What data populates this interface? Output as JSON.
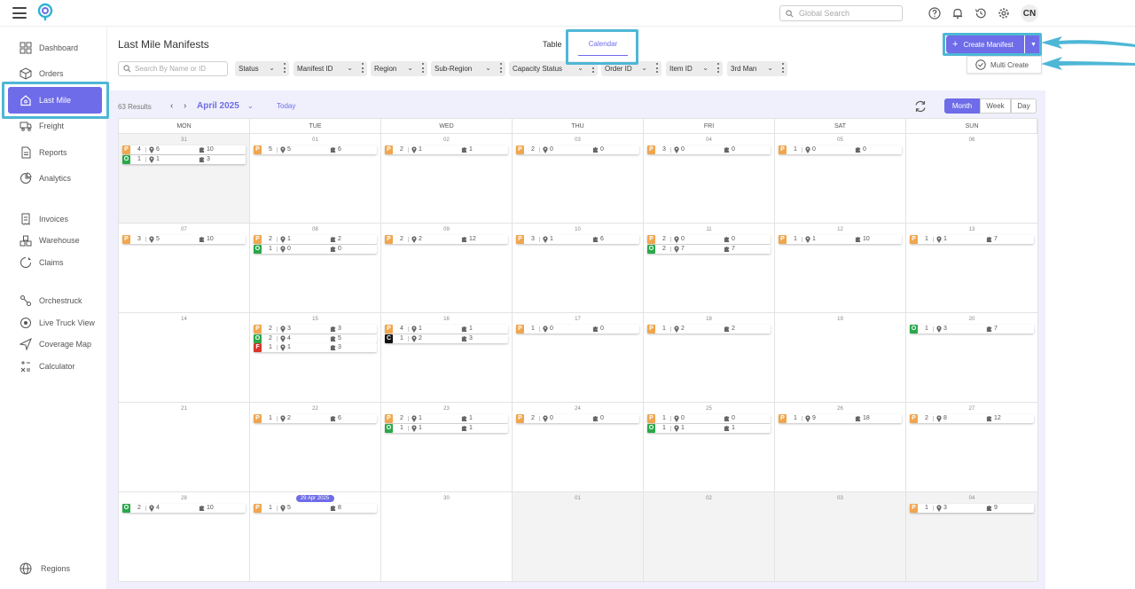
{
  "app": {
    "logo": "logo-mark"
  },
  "topbar": {
    "search_placeholder": "Global Search",
    "user_initials": "CN"
  },
  "sidebar": {
    "items": [
      {
        "label": "Dashboard",
        "icon": "dashboard-icon"
      },
      {
        "label": "Orders",
        "icon": "box-icon"
      },
      {
        "label": "Last Mile",
        "icon": "house-icon"
      },
      {
        "label": "Freight",
        "icon": "truck-icon"
      },
      {
        "label": "Reports",
        "icon": "report-icon"
      },
      {
        "label": "Analytics",
        "icon": "analytics-icon"
      },
      {
        "label": "Invoices",
        "icon": "invoice-icon"
      },
      {
        "label": "Warehouse",
        "icon": "warehouse-icon"
      },
      {
        "label": "Claims",
        "icon": "claims-icon"
      },
      {
        "label": "Orchestruck",
        "icon": "orchestruck-icon"
      },
      {
        "label": "Live Truck View",
        "icon": "live-icon"
      },
      {
        "label": "Coverage Map",
        "icon": "map-icon"
      },
      {
        "label": "Calculator",
        "icon": "calculator-icon"
      }
    ],
    "footer_label": "Regions"
  },
  "page": {
    "title": "Last Mile Manifests",
    "tabs": [
      "Table",
      "Calendar"
    ],
    "create_label": "Create Manifest",
    "multi_create_label": "Multi Create"
  },
  "filters": {
    "search_placeholder": "Search By Name or ID",
    "chips": [
      "Status",
      "Manifest ID",
      "Region",
      "Sub-Region",
      "Capacity Status",
      "Order ID",
      "Item ID",
      "3rd Man"
    ]
  },
  "calendar": {
    "results": "63 Results",
    "month_label": "April 2025",
    "today_label": "Today",
    "views": [
      "Month",
      "Week",
      "Day"
    ],
    "active_view": "Month",
    "weekdays": [
      "MON",
      "TUE",
      "WED",
      "THU",
      "FRI",
      "SAT",
      "SUN"
    ],
    "status_colors": {
      "P": "#f0a64e",
      "O": "#2aa84a",
      "C": "#111111",
      "F": "#d9352c"
    },
    "days": [
      {
        "d": "31",
        "other": true,
        "entries": [
          [
            "P",
            "4",
            "6",
            "10"
          ],
          [
            "O",
            "1",
            "1",
            "3"
          ]
        ]
      },
      {
        "d": "01",
        "entries": [
          [
            "P",
            "5",
            "5",
            "6"
          ]
        ]
      },
      {
        "d": "02",
        "entries": [
          [
            "P",
            "2",
            "1",
            "1"
          ]
        ]
      },
      {
        "d": "03",
        "entries": [
          [
            "P",
            "2",
            "0",
            "0"
          ]
        ]
      },
      {
        "d": "04",
        "entries": [
          [
            "P",
            "3",
            "0",
            "0"
          ]
        ]
      },
      {
        "d": "05",
        "entries": [
          [
            "P",
            "1",
            "0",
            "0"
          ]
        ]
      },
      {
        "d": "06",
        "entries": []
      },
      {
        "d": "07",
        "entries": [
          [
            "P",
            "3",
            "5",
            "10"
          ]
        ]
      },
      {
        "d": "08",
        "entries": [
          [
            "P",
            "2",
            "1",
            "2"
          ],
          [
            "O",
            "1",
            "0",
            "0"
          ]
        ]
      },
      {
        "d": "09",
        "entries": [
          [
            "P",
            "2",
            "2",
            "12"
          ]
        ]
      },
      {
        "d": "10",
        "entries": [
          [
            "P",
            "3",
            "1",
            "6"
          ]
        ]
      },
      {
        "d": "11",
        "entries": [
          [
            "P",
            "2",
            "0",
            "0"
          ],
          [
            "O",
            "2",
            "7",
            "7"
          ]
        ]
      },
      {
        "d": "12",
        "entries": [
          [
            "P",
            "1",
            "1",
            "10"
          ]
        ]
      },
      {
        "d": "13",
        "entries": [
          [
            "P",
            "1",
            "1",
            "7"
          ]
        ]
      },
      {
        "d": "14",
        "entries": []
      },
      {
        "d": "15",
        "entries": [
          [
            "P",
            "2",
            "3",
            "3"
          ],
          [
            "O",
            "2",
            "4",
            "5"
          ],
          [
            "F",
            "1",
            "1",
            "3"
          ]
        ]
      },
      {
        "d": "16",
        "entries": [
          [
            "P",
            "4",
            "1",
            "1"
          ],
          [
            "C",
            "1",
            "2",
            "3"
          ]
        ]
      },
      {
        "d": "17",
        "entries": [
          [
            "P",
            "1",
            "0",
            "0"
          ]
        ]
      },
      {
        "d": "18",
        "entries": [
          [
            "P",
            "1",
            "2",
            "2"
          ]
        ]
      },
      {
        "d": "19",
        "entries": []
      },
      {
        "d": "20",
        "entries": [
          [
            "O",
            "1",
            "3",
            "7"
          ]
        ]
      },
      {
        "d": "21",
        "entries": []
      },
      {
        "d": "22",
        "entries": [
          [
            "P",
            "1",
            "2",
            "6"
          ]
        ]
      },
      {
        "d": "23",
        "entries": [
          [
            "P",
            "2",
            "1",
            "1"
          ],
          [
            "O",
            "1",
            "1",
            "1"
          ]
        ]
      },
      {
        "d": "24",
        "entries": [
          [
            "P",
            "2",
            "0",
            "0"
          ]
        ]
      },
      {
        "d": "25",
        "entries": [
          [
            "P",
            "1",
            "0",
            "0"
          ],
          [
            "O",
            "1",
            "1",
            "1"
          ]
        ]
      },
      {
        "d": "26",
        "entries": [
          [
            "P",
            "1",
            "9",
            "18"
          ]
        ]
      },
      {
        "d": "27",
        "entries": [
          [
            "P",
            "2",
            "8",
            "12"
          ]
        ]
      },
      {
        "d": "28",
        "entries": [
          [
            "O",
            "2",
            "4",
            "10"
          ]
        ]
      },
      {
        "d": "29 Apr 2025",
        "today": true,
        "entries": [
          [
            "P",
            "1",
            "5",
            "8"
          ]
        ]
      },
      {
        "d": "30",
        "entries": []
      },
      {
        "d": "01",
        "other": true,
        "entries": []
      },
      {
        "d": "02",
        "other": true,
        "entries": []
      },
      {
        "d": "03",
        "other": true,
        "entries": []
      },
      {
        "d": "04",
        "other": true,
        "entries": [
          [
            "P",
            "1",
            "3",
            "9"
          ]
        ]
      }
    ]
  }
}
